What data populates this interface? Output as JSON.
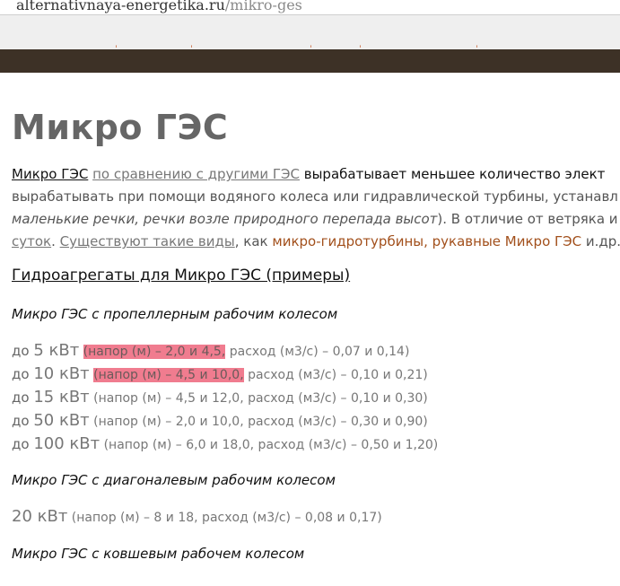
{
  "browser": {
    "url_domain": "alternativnaya-energetika.ru",
    "url_path": "/mikro-ges"
  },
  "colors": {
    "nav_background": "#3d3126",
    "highlight": "#f07c8f",
    "accent_link": "#a2501c"
  },
  "article": {
    "title": "Микро ГЭС",
    "intro": {
      "line1": {
        "link1": "Микро ГЭС",
        "link2": "по сравнению с другими ГЭС",
        "rest": " вырабатывает меньшее количество элект"
      },
      "line2": "вырабатывать при помощи водяного колеса или гидравлической турбины, устанавл",
      "line3": {
        "italic": "маленькие речки, речки возле природного перепада высот",
        "rest": "). В отличие от ветряка и диз"
      },
      "line4": {
        "link1": "суток",
        "sep": ". ",
        "link2": "Существуют такие виды",
        "mid": ", как ",
        "link3": "микро-гидротурбины",
        "comma": ", ",
        "link4": "рукавные Микро ГЭС",
        "rest": " и.др."
      }
    },
    "section_heading": "Гидроагрегаты для Микро ГЭС (примеры)",
    "groups": [
      {
        "title": "Микро ГЭС с пропеллерным рабочим колесом",
        "rows": [
          {
            "prefix": "до ",
            "power": "5 кВт",
            "head": "(напор (м) – 2,0 и 4,5,",
            "flow": " расход (м3/с) – 0,07 и 0,14)"
          },
          {
            "prefix": "до ",
            "power": "10 кВт",
            "head": "(напор (м) – 4,5 и 10,0,",
            "flow": " расход (м3/с) – 0,10 и 0,21)"
          },
          {
            "prefix": "до ",
            "power": "15 кВт",
            "head": "(напор (м) – 4,5 и 12,0,",
            "flow": " расход (м3/с) – 0,10 и 0,30)"
          },
          {
            "prefix": "до ",
            "power": "50 кВт",
            "head": "(напор (м) – 2,0 и 10,0,",
            "flow": " расход (м3/с) – 0,30 и 0,90)"
          },
          {
            "prefix": "до ",
            "power": "100 кВт",
            "head": "(напор (м) – 6,0 и 18,0,",
            "flow": " расход (м3/с) – 0,50 и 1,20)"
          }
        ]
      },
      {
        "title": "Микро ГЭС с диагоналевым рабочим колесом",
        "rows": [
          {
            "prefix": "",
            "power": "20 кВт",
            "head": "(напор (м) – 8 и 18,",
            "flow": " расход (м3/с) – 0,08 и 0,17)"
          }
        ]
      },
      {
        "title": "Микро ГЭС с ковшевым рабочем колесом"
      }
    ]
  }
}
